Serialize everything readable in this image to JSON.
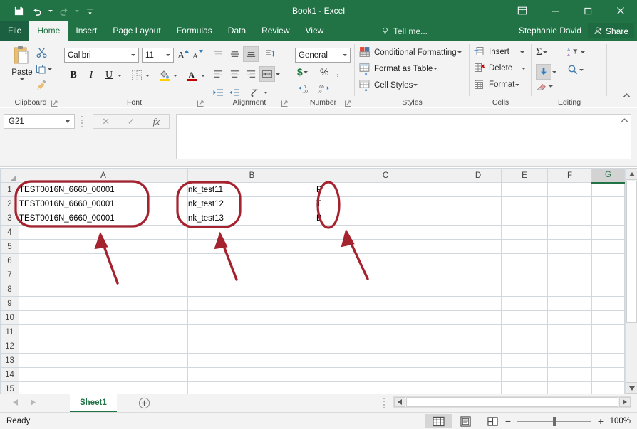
{
  "window": {
    "title": "Book1 - Excel",
    "qat": [
      {
        "name": "save-icon",
        "label": "Save"
      },
      {
        "name": "undo-icon",
        "label": "Undo"
      },
      {
        "name": "redo-icon",
        "label": "Redo"
      },
      {
        "name": "customize-qat-icon",
        "label": "Customize Quick Access Toolbar"
      }
    ],
    "controls": [
      {
        "name": "ribbon-display-options-icon",
        "label": "Ribbon Display Options"
      },
      {
        "name": "minimize-icon",
        "label": "Minimize"
      },
      {
        "name": "maximize-icon",
        "label": "Maximize"
      },
      {
        "name": "close-icon",
        "label": "Close"
      }
    ]
  },
  "tabs": {
    "items": [
      {
        "label": "File",
        "active": false
      },
      {
        "label": "Home",
        "active": true
      },
      {
        "label": "Insert",
        "active": false
      },
      {
        "label": "Page Layout",
        "active": false
      },
      {
        "label": "Formulas",
        "active": false
      },
      {
        "label": "Data",
        "active": false
      },
      {
        "label": "Review",
        "active": false
      },
      {
        "label": "View",
        "active": false
      }
    ],
    "tell_me": "Tell me...",
    "account": "Stephanie David",
    "share": "Share"
  },
  "ribbon": {
    "clipboard": {
      "label": "Clipboard",
      "paste": "Paste",
      "cut": "Cut",
      "copy": "Copy",
      "format_painter": "Format Painter"
    },
    "font": {
      "label": "Font",
      "font_name": "Calibri",
      "font_size": "11",
      "grow": "Increase Font Size",
      "shrink": "Decrease Font Size",
      "bold": "B",
      "italic": "I",
      "underline": "U",
      "borders": "Borders",
      "fill_color": "Fill Color",
      "font_color": "Font Color"
    },
    "alignment": {
      "label": "Alignment",
      "align_top": "Top Align",
      "align_middle": "Middle Align",
      "align_bottom": "Bottom Align",
      "orientation": "Orientation",
      "align_left": "Align Left",
      "align_center": "Center",
      "align_right": "Align Right",
      "wrap_text": "Wrap Text",
      "merge_center": "Merge & Center",
      "decrease_indent": "Decrease Indent",
      "increase_indent": "Increase Indent"
    },
    "number": {
      "label": "Number",
      "format": "General",
      "accounting": "Accounting Number Format",
      "percent": "%",
      "comma": ",",
      "increase_decimal": "Increase Decimal",
      "decrease_decimal": "Decrease Decimal"
    },
    "styles": {
      "label": "Styles",
      "conditional_formatting": "Conditional Formatting",
      "format_as_table": "Format as Table",
      "cell_styles": "Cell Styles"
    },
    "cells": {
      "label": "Cells",
      "insert": "Insert",
      "delete": "Delete",
      "format": "Format"
    },
    "editing": {
      "label": "Editing",
      "autosum": "AutoSum",
      "fill": "Fill",
      "clear": "Clear",
      "sort_filter": "Sort & Filter",
      "find_select": "Find & Select"
    },
    "collapse": "Collapse the Ribbon"
  },
  "formula_bar": {
    "name_box": "G21",
    "cancel": "Cancel",
    "enter": "Enter",
    "insert_function": "fx",
    "value": "",
    "placeholder": "",
    "collapse": "Collapse Formula Bar"
  },
  "grid": {
    "columns": [
      "A",
      "B",
      "C",
      "D",
      "E",
      "F",
      "G"
    ],
    "selected_column": "G",
    "rows": [
      "1",
      "2",
      "3",
      "4",
      "5",
      "6",
      "7",
      "8",
      "9",
      "10",
      "11",
      "12",
      "13",
      "14",
      "15"
    ],
    "cells": [
      [
        "TEST0016N_6660_00001",
        "nk_test11",
        "P",
        "",
        "",
        "",
        ""
      ],
      [
        "TEST0016N_6660_00001",
        "nk_test12",
        "T",
        "",
        "",
        "",
        ""
      ],
      [
        "TEST0016N_6660_00001",
        "nk_test13",
        "B",
        "",
        "",
        "",
        ""
      ],
      [
        "",
        "",
        "",
        "",
        "",
        "",
        ""
      ],
      [
        "",
        "",
        "",
        "",
        "",
        "",
        ""
      ],
      [
        "",
        "",
        "",
        "",
        "",
        "",
        ""
      ],
      [
        "",
        "",
        "",
        "",
        "",
        "",
        ""
      ],
      [
        "",
        "",
        "",
        "",
        "",
        "",
        ""
      ],
      [
        "",
        "",
        "",
        "",
        "",
        "",
        ""
      ],
      [
        "",
        "",
        "",
        "",
        "",
        "",
        ""
      ],
      [
        "",
        "",
        "",
        "",
        "",
        "",
        ""
      ],
      [
        "",
        "",
        "",
        "",
        "",
        "",
        ""
      ],
      [
        "",
        "",
        "",
        "",
        "",
        "",
        ""
      ],
      [
        "",
        "",
        "",
        "",
        "",
        "",
        ""
      ],
      [
        "",
        "",
        "",
        "",
        "",
        "",
        ""
      ]
    ]
  },
  "annotations": {
    "color": "#A5232F",
    "shapes": [
      {
        "name": "annotation-oval-column-a",
        "type": "rounded-rect",
        "target": "A1:A3"
      },
      {
        "name": "annotation-oval-column-b",
        "type": "rounded-rect",
        "target": "B1:B3"
      },
      {
        "name": "annotation-oval-column-c",
        "type": "oval",
        "target": "C1:C3"
      },
      {
        "name": "annotation-arrow-column-a",
        "type": "arrow"
      },
      {
        "name": "annotation-arrow-column-b",
        "type": "arrow"
      },
      {
        "name": "annotation-arrow-column-c",
        "type": "arrow"
      }
    ]
  },
  "sheet_tabs": {
    "prev": "Previous Sheet",
    "next": "Next Sheet",
    "sheets": [
      {
        "label": "Sheet1",
        "active": true
      }
    ],
    "add": "New sheet"
  },
  "status_bar": {
    "status": "Ready",
    "views": [
      {
        "name": "normal-view-icon",
        "label": "Normal",
        "active": true
      },
      {
        "name": "page-layout-view-icon",
        "label": "Page Layout",
        "active": false
      },
      {
        "name": "page-break-preview-icon",
        "label": "Page Break Preview",
        "active": false
      }
    ],
    "zoom_out": "−",
    "zoom_in": "+",
    "zoom_level": "100%"
  }
}
